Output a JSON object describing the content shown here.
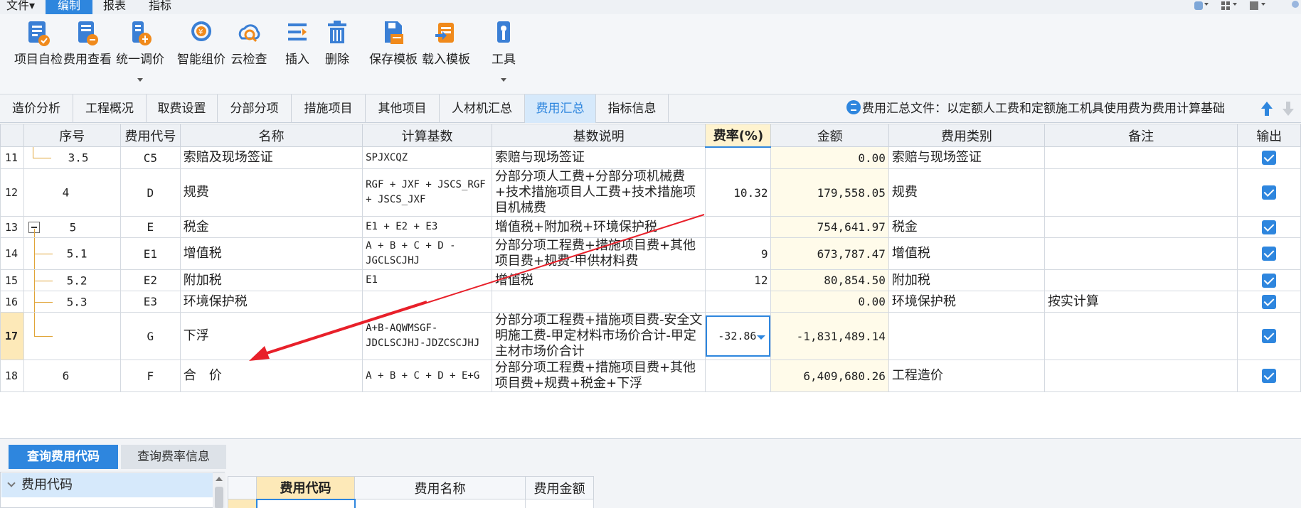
{
  "menubar": {
    "items": [
      {
        "label": "文件▾"
      },
      {
        "label": "编制"
      },
      {
        "label": "报表"
      },
      {
        "label": "指标"
      }
    ]
  },
  "ribbon": {
    "buttons": [
      {
        "label": "项目自检",
        "icon": "checklist-icon"
      },
      {
        "label": "费用查看",
        "icon": "fee-view-icon"
      },
      {
        "label": "统一调价",
        "icon": "unified-price-icon"
      },
      {
        "label": "智能组价",
        "icon": "smart-price-icon"
      },
      {
        "label": "云检查",
        "icon": "cloud-check-icon"
      },
      {
        "label": "插入",
        "icon": "insert-icon"
      },
      {
        "label": "删除",
        "icon": "delete-icon"
      },
      {
        "label": "保存模板",
        "icon": "save-template-icon"
      },
      {
        "label": "载入模板",
        "icon": "load-template-icon"
      },
      {
        "label": "工具",
        "icon": "tools-icon"
      }
    ]
  },
  "tabs": [
    {
      "label": "造价分析"
    },
    {
      "label": "工程概况"
    },
    {
      "label": "取费设置"
    },
    {
      "label": "分部分项"
    },
    {
      "label": "措施项目"
    },
    {
      "label": "其他项目"
    },
    {
      "label": "人材机汇总"
    },
    {
      "label": "费用汇总"
    },
    {
      "label": "指标信息"
    }
  ],
  "file_info": "费用汇总文件：以定额人工费和定额施工机具使用费为费用计算基础",
  "table": {
    "headers": {
      "seq": "序号",
      "code": "费用代号",
      "name": "名称",
      "base": "计算基数",
      "desc": "基数说明",
      "rate": "费率(%)",
      "amount": "金额",
      "category": "费用类别",
      "remark": "备注",
      "output": "输出"
    },
    "rows": [
      {
        "rownum": "11",
        "seq": "3.5",
        "code": "C5",
        "name": "索赔及现场签证",
        "base": "SPJXCQZ",
        "desc": "索赔与现场签证",
        "rate": "",
        "amount": "0.00",
        "category": "索赔与现场签证",
        "remark": "",
        "output": true
      },
      {
        "rownum": "12",
        "seq": "4",
        "code": "D",
        "name": "规费",
        "base": "RGF + JXF + JSCS_RGF + JSCS_JXF",
        "desc": "分部分项人工费+分部分项机械费+技术措施项目人工费+技术措施项目机械费",
        "rate": "10.32",
        "amount": "179,558.05",
        "category": "规费",
        "remark": "",
        "output": true
      },
      {
        "rownum": "13",
        "seq": "5",
        "code": "E",
        "name": "税金",
        "base": "E1 + E2 + E3",
        "desc": "增值税+附加税+环境保护税",
        "rate": "",
        "amount": "754,641.97",
        "category": "税金",
        "remark": "",
        "output": true
      },
      {
        "rownum": "14",
        "seq": "5.1",
        "code": "E1",
        "name": "增值税",
        "base": "A + B + C + D - JGCLSCJHJ",
        "desc": "分部分项工程费+措施项目费+其他项目费+规费-甲供材料费",
        "rate": "9",
        "amount": "673,787.47",
        "category": "增值税",
        "remark": "",
        "output": true
      },
      {
        "rownum": "15",
        "seq": "5.2",
        "code": "E2",
        "name": "附加税",
        "base": "E1",
        "desc": "增值税",
        "rate": "12",
        "amount": "80,854.50",
        "category": "附加税",
        "remark": "",
        "output": true
      },
      {
        "rownum": "16",
        "seq": "5.3",
        "code": "E3",
        "name": "环境保护税",
        "base": "",
        "desc": "",
        "rate": "",
        "amount": "0.00",
        "category": "环境保护税",
        "remark": "按实计算",
        "output": true
      },
      {
        "rownum": "17",
        "seq": "",
        "code": "G",
        "name": "下浮",
        "base": "A+B-AQWMSGF-JDCLSCJHJ-JDZCSCJHJ",
        "desc": "分部分项工程费+措施项目费-安全文明施工费-甲定材料市场价合计-甲定主材市场价合计",
        "rate": "-32.86",
        "amount": "-1,831,489.14",
        "category": "",
        "remark": "",
        "output": true
      },
      {
        "rownum": "18",
        "seq": "6",
        "code": "F",
        "name": "合　价",
        "base": "A + B + C + D + E+G",
        "desc": "分部分项工程费+措施项目费+其他项目费+规费+税金+下浮",
        "rate": "",
        "amount": "6,409,680.26",
        "category": "工程造价",
        "remark": "",
        "output": true
      }
    ]
  },
  "bottom": {
    "tabs": [
      {
        "label": "查询费用代码"
      },
      {
        "label": "查询费率信息"
      }
    ],
    "tree_item": "费用代码",
    "subtable_headers": {
      "code": "费用代码",
      "name": "费用名称",
      "amount": "费用金额"
    }
  },
  "colors": {
    "accent": "#2e86de",
    "selected_row": "#fde9b8",
    "amount_bg": "#fffbea",
    "annotation_arrow": "#e8202a"
  }
}
